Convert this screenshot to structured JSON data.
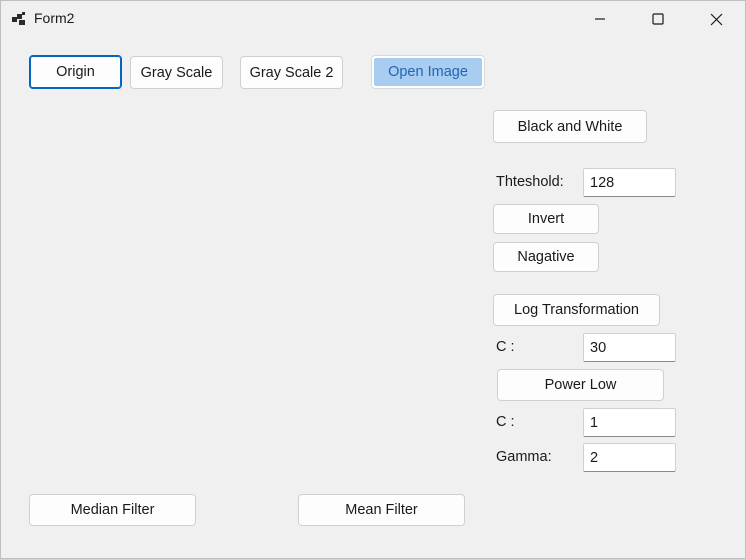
{
  "window": {
    "title": "Form2"
  },
  "buttons": {
    "origin": "Origin",
    "gray_scale": "Gray Scale",
    "gray_scale_2": "Gray Scale 2",
    "open_image": "Open Image",
    "black_and_white": "Black and White",
    "invert": "Invert",
    "negative": "Nagative",
    "log_transformation": "Log Transformation",
    "power_low": "Power Low",
    "median_filter": "Median Filter",
    "mean_filter": "Mean Filter"
  },
  "threshold": {
    "label": "Thteshold:",
    "value": "128"
  },
  "log": {
    "c_label": "C :",
    "c_value": "30"
  },
  "power": {
    "c_label": "C :",
    "c_value": "1",
    "gamma_label": "Gamma:",
    "gamma_value": "2"
  },
  "icons": {
    "app": "app-window-icon",
    "minimize": "minimize-icon",
    "maximize": "maximize-icon",
    "close": "close-icon"
  }
}
